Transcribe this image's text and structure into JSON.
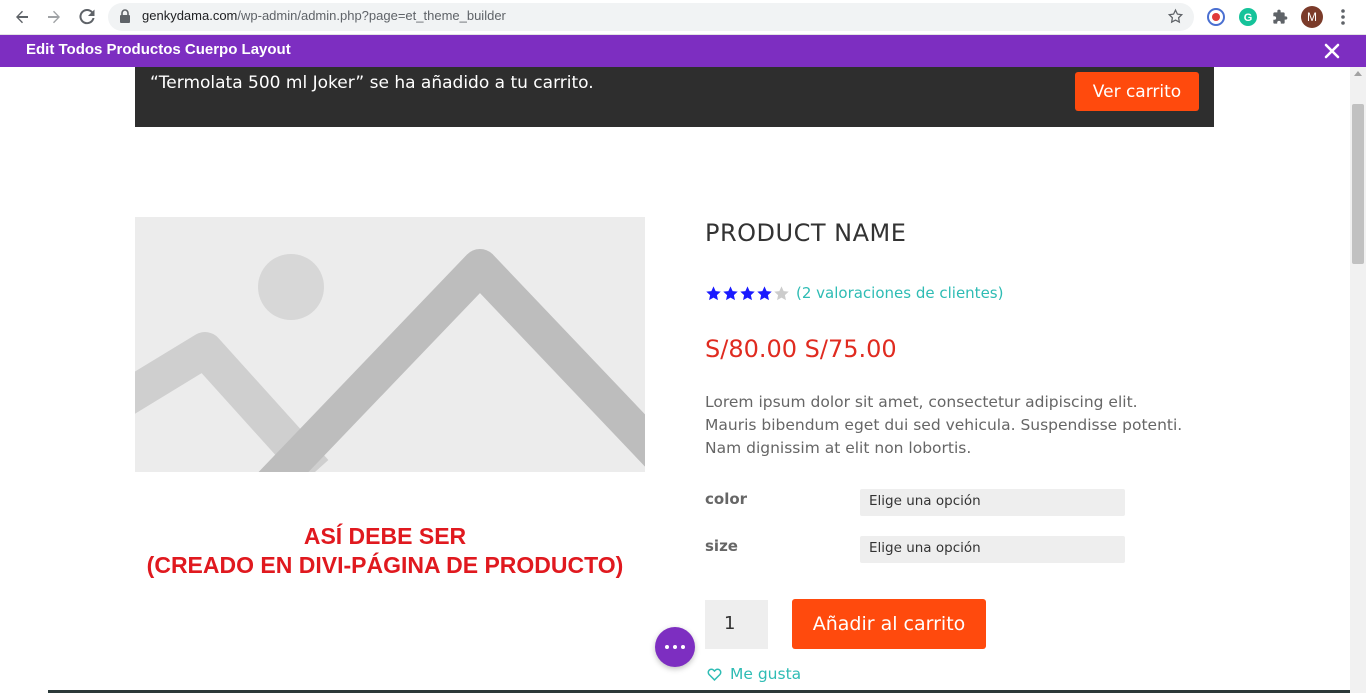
{
  "browser": {
    "url_host": "genkydama.com",
    "url_path": "/wp-admin/admin.php?page=et_theme_builder",
    "avatar_letter": "M",
    "icons": [
      "back-icon",
      "forward-icon",
      "reload-icon",
      "lock-icon",
      "bookmark-star-icon",
      "extension-icon",
      "grammarly-icon",
      "puzzle-icon",
      "menu-dots-icon"
    ]
  },
  "divi_bar": {
    "title": "Edit Todos Productos Cuerpo Layout",
    "color": "#7d2ec1"
  },
  "notice": {
    "message": "“Termolata 500 ml Joker” se ha añadido a tu carrito.",
    "button_label": "Ver carrito"
  },
  "annotation": {
    "line1": "ASÍ DEBE SER",
    "line2": "(CREADO EN DIVI-PÁGINA DE PRODUCTO)",
    "color": "#e0191f"
  },
  "product": {
    "name": "PRODUCT NAME",
    "rating": 4,
    "rating_max": 5,
    "reviews_label": "(2 valoraciones de clientes)",
    "price": "S/80.00 S/75.00",
    "description": "Lorem ipsum dolor sit amet, consectetur adipiscing elit. Mauris bibendum eget dui sed vehicula. Suspendisse potenti. Nam dignissim at elit non lobortis.",
    "variations": [
      {
        "label": "color",
        "selected": "Elige una opción"
      },
      {
        "label": "size",
        "selected": "Elige una opción"
      }
    ],
    "quantity": "1",
    "add_to_cart_label": "Añadir al carrito",
    "like_label": "Me gusta"
  },
  "colors": {
    "accent_orange": "#ff4a0d",
    "teal_link": "#2ebcb4",
    "price_red": "#e02b20",
    "star_blue": "#1a1aff"
  }
}
